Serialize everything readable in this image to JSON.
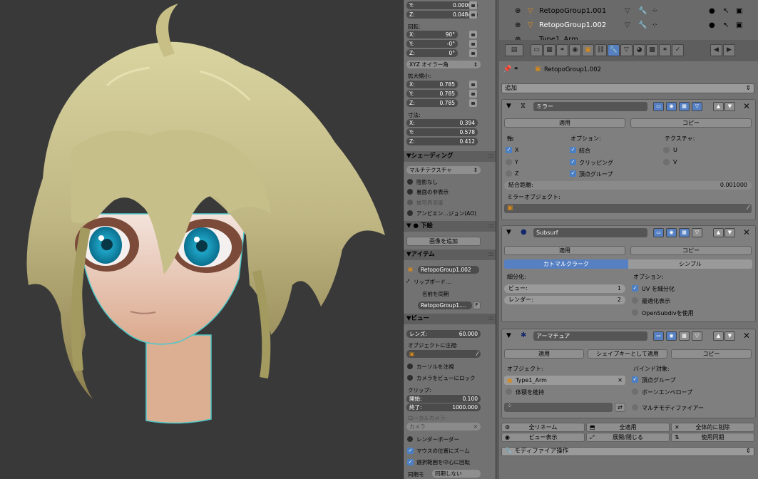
{
  "colors": {
    "accent": "#5680c2",
    "viewport_bg": "#393939",
    "panel_bg": "#727272"
  },
  "npanel": {
    "loc_y": {
      "label": "Y:",
      "value": "0.00000"
    },
    "loc_z": {
      "label": "Z:",
      "value": "0.04841"
    },
    "rotation_label": "回転:",
    "rot": [
      {
        "label": "X:",
        "value": "90°"
      },
      {
        "label": "Y:",
        "value": "-0°"
      },
      {
        "label": "Z:",
        "value": "0°"
      }
    ],
    "rotation_mode": "XYZ オイラー角",
    "scale_label": "拡大縮小:",
    "scale": [
      {
        "label": "X:",
        "value": "0.785"
      },
      {
        "label": "Y:",
        "value": "0.785"
      },
      {
        "label": "Z:",
        "value": "0.785"
      }
    ],
    "dimensions_label": "寸法:",
    "dims": [
      {
        "label": "X:",
        "value": "0.394"
      },
      {
        "label": "Y:",
        "value": "0.578"
      },
      {
        "label": "Z:",
        "value": "0.412"
      }
    ],
    "shading_header": "▼シェーディング",
    "shading_mode": "マルチテクスチャ",
    "shading_opts": [
      "陰影なし",
      "裏面の非表示",
      "被写界深度",
      "アンビエン…ジョン(AO)"
    ],
    "background_header": "▼ ● 下絵",
    "add_image": "画像を追加",
    "item_header": "▼アイテム",
    "item_name": "RetopoGroup1.002",
    "rig_board": "リップボード…",
    "sync_name": "名前を同期",
    "item_data": "RetopoGroup1....",
    "item_data_f": "F",
    "view_header": "▼ビュー",
    "lens": {
      "label": "レンズ:",
      "value": "60.000"
    },
    "lock_to_object": "オブジェクトに注視:",
    "lock_cursor": "カーソルを注視",
    "lock_camera": "カメラをビューにロック",
    "clip_label": "クリップ:",
    "clip_start": {
      "label": "開始:",
      "value": "0.100"
    },
    "clip_end": {
      "label": "終了:",
      "value": "1000.000"
    },
    "local_camera_label": "ローカルカメラ:",
    "local_camera": "カメラ",
    "render_border": "レンダーボーダー",
    "zoom_mouse": "マウスの位置にズーム",
    "rotate_selection": "選択範囲を中心に回転",
    "sync_mode_label": "同期モ",
    "sync_mode_value": "同期しない"
  },
  "outliner": {
    "rows": [
      {
        "name": "RetopoGroup1.001"
      },
      {
        "name": "RetopoGroup1.002"
      },
      {
        "name": "Type1_Arm"
      }
    ]
  },
  "props": {
    "breadcrumb": "RetopoGroup1.002",
    "add_modifier": "追加",
    "mirror": {
      "name": "ミラー",
      "apply": "適用",
      "copy": "コピー",
      "axis_label": "軸:",
      "options_label": "オプション:",
      "texture_label": "テクスチャ:",
      "axes": [
        "X",
        "Y",
        "Z"
      ],
      "options": [
        "結合",
        "クリッピング",
        "頂点グループ"
      ],
      "textures": [
        "U",
        "V"
      ],
      "merge_label": "結合距離:",
      "merge_value": "0.001000",
      "mirror_object_label": "ミラーオブジェクト:"
    },
    "subsurf": {
      "name": "Subsurf",
      "apply": "適用",
      "copy": "コピー",
      "tab_catmull": "カトマルクラーク",
      "tab_simple": "シンプル",
      "subdiv_label": "細分化:",
      "options_label": "オプション:",
      "view_label": "ビュー:",
      "view_value": "1",
      "render_label": "レンダー:",
      "render_value": "2",
      "opt_uv": "UV を細分化",
      "opt_optimal": "最適化表示",
      "opt_opensubdiv": "OpenSubdivを使用"
    },
    "armature": {
      "name": "アーマチュア",
      "apply": "適用",
      "apply_shape": "シェイプキーとして適用",
      "copy": "コピー",
      "object_label": "オブジェクト:",
      "object_value": "Type1_Arm",
      "preserve_volume": "体積を維持",
      "bind_label": "バインド対象:",
      "bind_vgroups": "頂点グループ",
      "bind_envelopes": "ボーンエンベロープ",
      "multi_modifier": "マルチモディファイアー"
    },
    "tools": {
      "rename_all": "全リネーム",
      "apply_all": "全適用",
      "delete_all": "全体的に削除",
      "view_display": "ビュー表示",
      "toggle_expand": "展開/閉じる",
      "use_sync": "使用同期"
    },
    "modifier_ops": "モディファイア操作"
  }
}
